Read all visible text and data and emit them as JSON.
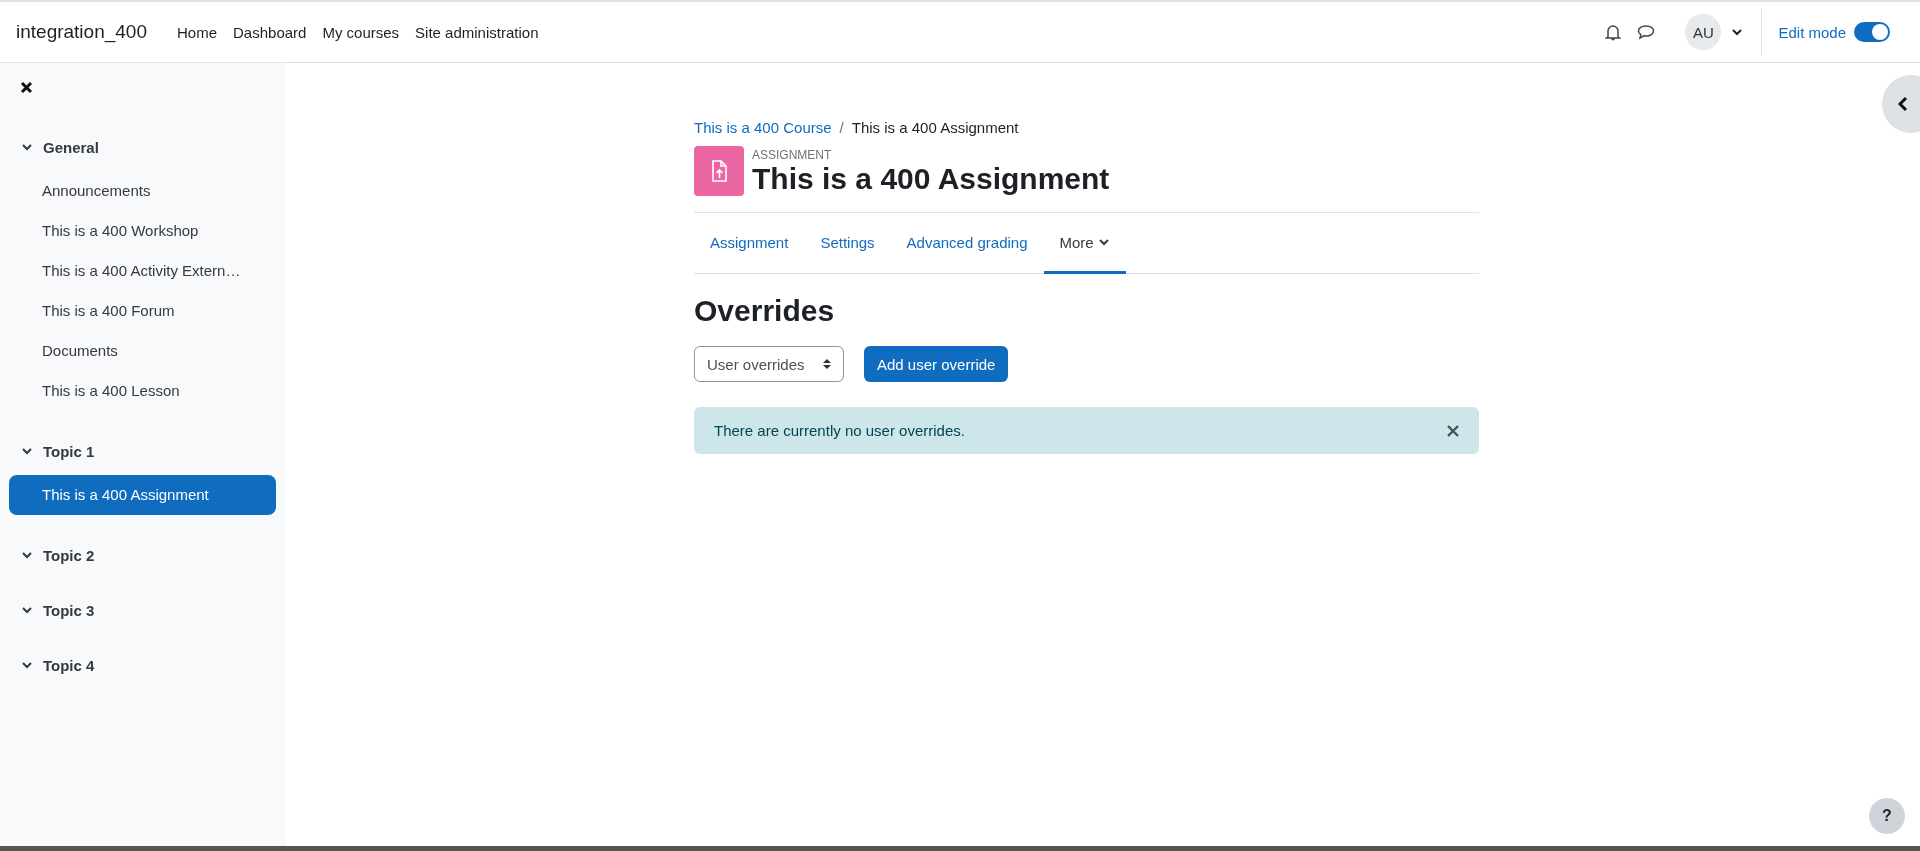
{
  "navbar": {
    "site_name": "integration_400",
    "links": [
      {
        "label": "Home"
      },
      {
        "label": "Dashboard"
      },
      {
        "label": "My courses"
      },
      {
        "label": "Site administration"
      }
    ],
    "user_initials": "AU",
    "edit_mode": {
      "label": "Edit mode",
      "on": true
    }
  },
  "sidebar": {
    "sections": [
      {
        "title": "General",
        "expanded": true,
        "children": [
          {
            "label": "Announcements",
            "selected": false
          },
          {
            "label": "This is a 400 Workshop",
            "selected": false
          },
          {
            "label": "This is a 400 Activity Extern…",
            "selected": false
          },
          {
            "label": "This is a 400 Forum",
            "selected": false
          },
          {
            "label": "Documents",
            "selected": false
          },
          {
            "label": "This is a 400 Lesson",
            "selected": false
          }
        ]
      },
      {
        "title": "Topic 1",
        "expanded": true,
        "children": [
          {
            "label": "This is a 400 Assignment",
            "selected": true
          }
        ]
      },
      {
        "title": "Topic 2",
        "expanded": true
      },
      {
        "title": "Topic 3",
        "expanded": true
      },
      {
        "title": "Topic 4",
        "expanded": true
      }
    ]
  },
  "breadcrumb": [
    {
      "label": "This is a 400 Course",
      "kind": "link"
    },
    {
      "label": "/",
      "kind": "separator"
    },
    {
      "label": "This is a 400 Assignment",
      "kind": "current"
    }
  ],
  "activity": {
    "type_label": "ASSIGNMENT",
    "title": "This is a 400 Assignment"
  },
  "tabs": [
    {
      "label": "Assignment",
      "selected": false,
      "dropdown": false
    },
    {
      "label": "Settings",
      "selected": false,
      "dropdown": false
    },
    {
      "label": "Advanced grading",
      "selected": false,
      "dropdown": false
    },
    {
      "label": "More",
      "selected": true,
      "dropdown": true
    }
  ],
  "heading": "Overrides",
  "override_select": {
    "value": "User overrides"
  },
  "add_button": "Add user override",
  "alert": {
    "message": "There are currently no user overrides."
  },
  "help_button": "?"
}
